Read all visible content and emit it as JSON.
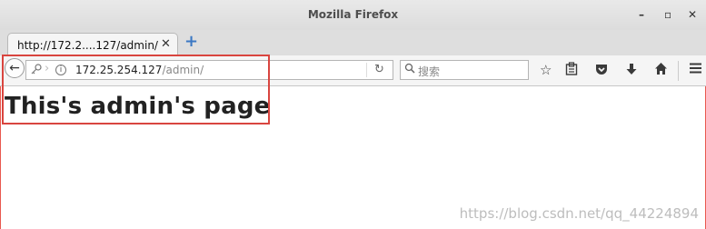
{
  "window": {
    "title": "Mozilla Firefox",
    "minimize_glyph": "–",
    "maximize_glyph": "▫",
    "close_glyph": "✕"
  },
  "tabs": [
    {
      "label": "http://172.2....127/admin/",
      "close_glyph": "✕"
    }
  ],
  "new_tab_glyph": "+",
  "navbar": {
    "back_glyph": "←",
    "url_host": "172.25.254.127",
    "url_path": "/admin/",
    "reload_glyph": "↻",
    "search_placeholder": "搜索",
    "icons": [
      "back-icon",
      "key-icon",
      "info-icon",
      "reload-icon",
      "search-icon",
      "bookmark-star-icon",
      "reading-list-icon",
      "pocket-icon",
      "download-icon",
      "home-icon",
      "menu-icon"
    ]
  },
  "page": {
    "heading": "This's admin's page"
  },
  "watermark": "https://blog.csdn.net/qq_44224894",
  "colors": {
    "annotation_border": "#d9453f",
    "newtab_accent": "#3b78c4"
  }
}
